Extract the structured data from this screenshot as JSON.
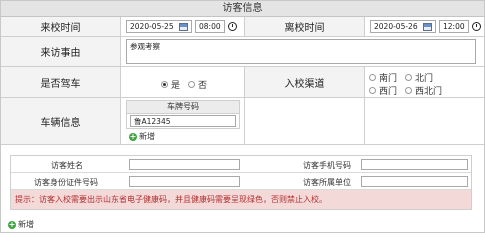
{
  "title": "访客信息",
  "visit_time": {
    "label": "来校时间",
    "date": "2020-05-25",
    "time": "08:00"
  },
  "leave_time": {
    "label": "离校时间",
    "date": "2020-05-26",
    "time": "12:00"
  },
  "reason": {
    "label": "来访事由",
    "value": "参观考察"
  },
  "drive": {
    "label": "是否驾车",
    "options": [
      "是",
      "否"
    ],
    "selected": "是"
  },
  "gate": {
    "label": "入校渠道",
    "options": [
      "南门",
      "北门",
      "西门",
      "西北门"
    ]
  },
  "vehicle": {
    "label": "车辆信息",
    "plate_header": "车牌号码",
    "plate_value": "鲁A12345",
    "add_label": "新增"
  },
  "visitor": {
    "name_label": "访客姓名",
    "phone_label": "访客手机号码",
    "id_label": "访客身份证件号码",
    "unit_label": "访客所属单位",
    "notice": "提示：访客入校需要出示山东省电子健康码，并且健康码需要呈现绿色，否则禁止入校。"
  },
  "add_visitor_label": "新增"
}
